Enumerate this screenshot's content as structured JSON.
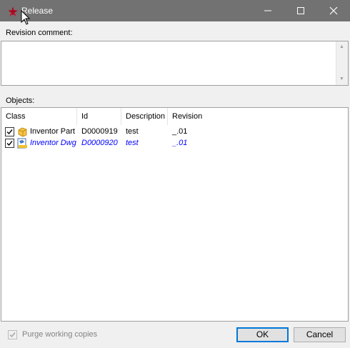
{
  "window": {
    "title": "Release"
  },
  "comment": {
    "label": "Revision comment:",
    "value": ""
  },
  "objects": {
    "label": "Objects:",
    "columns": [
      "Class",
      "Id",
      "Description",
      "Revision"
    ],
    "rows": [
      {
        "checked": true,
        "icon": "inventor-part-icon",
        "class": "Inventor Part",
        "id": "D0000919",
        "description": "test",
        "revision": "_.01"
      },
      {
        "checked": true,
        "icon": "inventor-dwg-icon",
        "class": "Inventor Dwg",
        "id": "D0000920",
        "description": "test",
        "revision": "_.01"
      }
    ]
  },
  "purge": {
    "label": "Purge working copies",
    "checked": true,
    "enabled": false
  },
  "buttons": {
    "ok": "OK",
    "cancel": "Cancel"
  },
  "colors": {
    "titlebar": "#727272",
    "link_blue": "#0000ff",
    "accent": "#0078d7"
  }
}
